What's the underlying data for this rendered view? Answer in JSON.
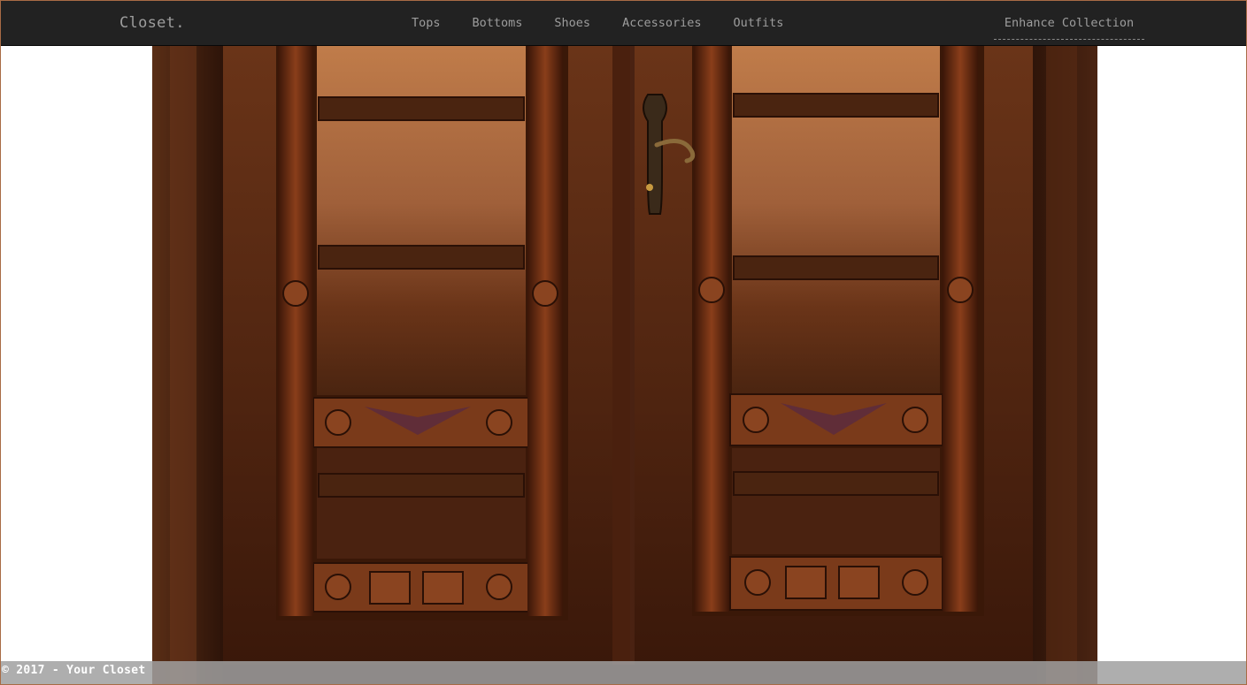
{
  "navbar": {
    "brand": "Closet.",
    "links": [
      {
        "label": "Tops"
      },
      {
        "label": "Bottoms"
      },
      {
        "label": "Shoes"
      },
      {
        "label": "Accessories"
      },
      {
        "label": "Outfits"
      }
    ],
    "right_link": "Enhance Collection"
  },
  "hero": {
    "image_subject": "carved-wooden-wardrobe-doors"
  },
  "footer": {
    "text": "© 2017 - Your Closet"
  },
  "colors": {
    "navbar_bg": "#222222",
    "nav_text": "#9d9d9d",
    "footer_bg": "#a0a0a0",
    "wood_light": "#b87848",
    "wood_dark": "#3a1a0c"
  }
}
